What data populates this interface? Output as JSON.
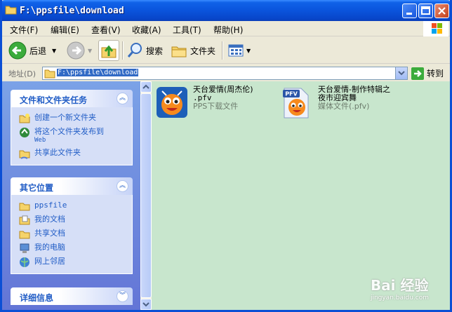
{
  "window": {
    "title": "F:\\ppsfile\\download"
  },
  "menu": [
    "文件(F)",
    "编辑(E)",
    "查看(V)",
    "收藏(A)",
    "工具(T)",
    "帮助(H)"
  ],
  "toolbar": {
    "back_label": "后退",
    "search_label": "搜索",
    "folders_label": "文件夹"
  },
  "address": {
    "label": "地址(D)",
    "value": "F:\\ppsfile\\download",
    "go_label": "转到"
  },
  "panels": {
    "tasks": {
      "title": "文件和文件夹任务",
      "items": [
        {
          "label": "创建一个新文件夹",
          "sub": ""
        },
        {
          "label": "将这个文件夹发布到",
          "sub": "Web"
        },
        {
          "label": "共享此文件夹",
          "sub": ""
        }
      ]
    },
    "places": {
      "title": "其它位置",
      "items": [
        "ppsfile",
        "我的文档",
        "共享文档",
        "我的电脑",
        "网上邻居"
      ]
    },
    "details": {
      "title": "详细信息"
    }
  },
  "files": [
    {
      "name_line1": "天台爱情(周杰伦)",
      "name_line2": ".pfv",
      "type": "PPS下载文件"
    },
    {
      "name_line1": "天台爱情-制作特辑之",
      "name_line2": "夜市迎宾舞",
      "type": "媒体文件(.pfv)"
    }
  ],
  "watermark": {
    "text": "Bai 经验",
    "url": "jingyan.baidu.com"
  }
}
